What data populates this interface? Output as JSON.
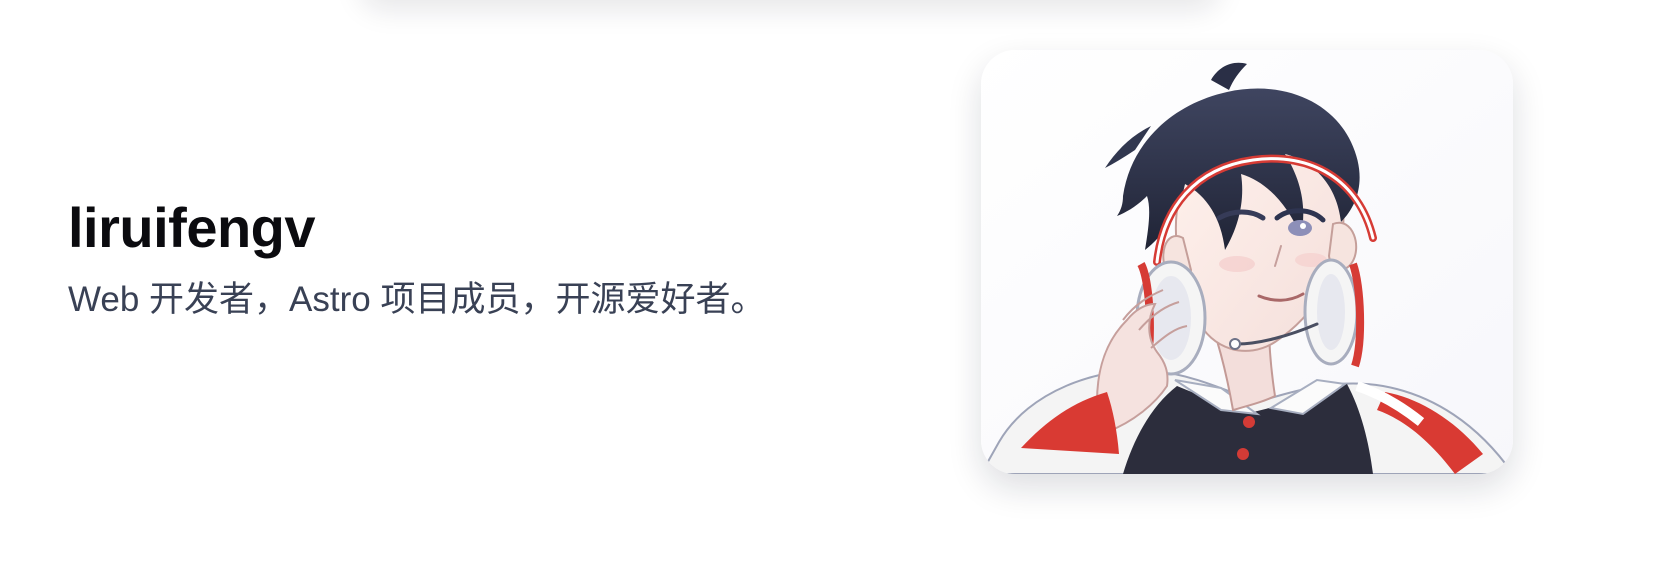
{
  "profile": {
    "name": "liruifengv",
    "bio": "Web 开发者，Astro 项目成员，开源爱好者。"
  },
  "avatar": {
    "icon": "anime-avatar-illustration"
  },
  "colors": {
    "name_text": "#0b0b0f",
    "bio_text": "#394155",
    "hair": "#2b2f45",
    "skin": "#f7e7e3",
    "jacket_red": "#d93a33",
    "jacket_white": "#f4f4f4",
    "shirt_dark": "#2c2d3c"
  }
}
